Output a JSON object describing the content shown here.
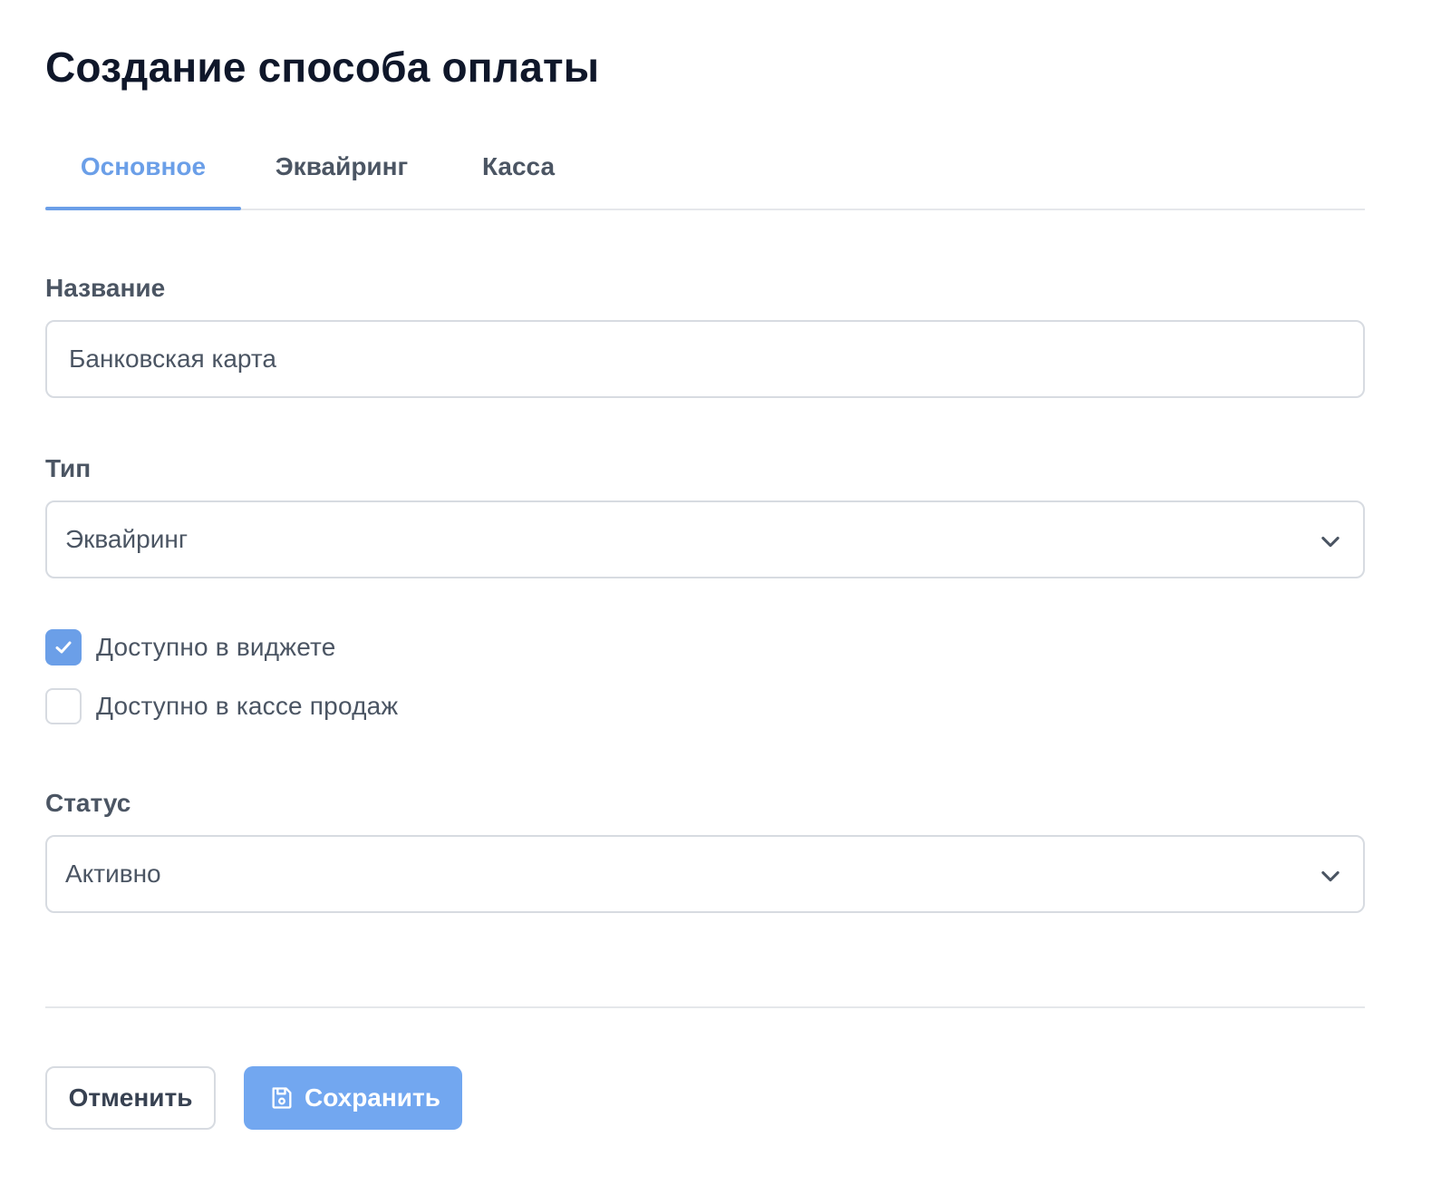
{
  "page": {
    "title": "Создание способа оплаты"
  },
  "tabs": [
    {
      "label": "Основное",
      "active": true
    },
    {
      "label": "Эквайринг",
      "active": false
    },
    {
      "label": "Касса",
      "active": false
    }
  ],
  "form": {
    "name": {
      "label": "Название",
      "value": "Банковская карта"
    },
    "type": {
      "label": "Тип",
      "selected": "Эквайринг"
    },
    "checkboxes": [
      {
        "label": "Доступно в виджете",
        "checked": true
      },
      {
        "label": "Доступно в кассе продаж",
        "checked": false
      }
    ],
    "status": {
      "label": "Статус",
      "selected": "Активно"
    }
  },
  "actions": {
    "cancel_label": "Отменить",
    "save_label": "Сохранить",
    "save_icon": "floppy-disk-icon"
  },
  "colors": {
    "accent": "#6b9fe8",
    "save_button": "#72a7f0",
    "border": "#d7dbe1",
    "text_muted": "#4b5563",
    "title": "#0f172a"
  }
}
